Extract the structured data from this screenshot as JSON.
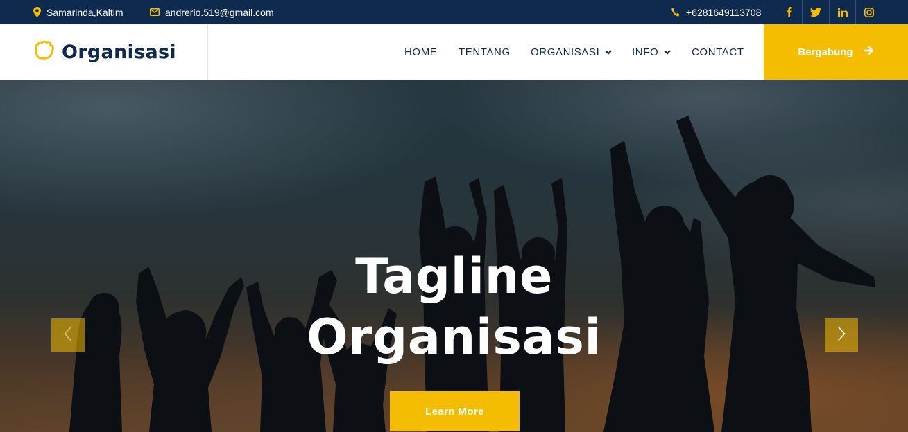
{
  "topbar": {
    "location": "Samarinda,Kaltim",
    "email": "andrerio.519@gmail.com",
    "phone": "+6281649113708",
    "social_icons": [
      "facebook-icon",
      "twitter-icon",
      "linkedin-icon",
      "instagram-icon"
    ]
  },
  "brand": {
    "name": "Organisasi",
    "icon": "glove-icon"
  },
  "nav": {
    "items": [
      {
        "label": "HOME"
      },
      {
        "label": "TENTANG"
      },
      {
        "label": "ORGANISASI",
        "dropdown": true
      },
      {
        "label": "INFO",
        "dropdown": true
      },
      {
        "label": "CONTACT"
      }
    ],
    "cta_label": "Bergabung"
  },
  "hero": {
    "title_line1": "Tagline",
    "title_line2": "Organisasi",
    "button_label": "Learn More"
  },
  "colors": {
    "navy": "#0e2a4f",
    "accent": "#f5bd02",
    "white": "#ffffff"
  }
}
